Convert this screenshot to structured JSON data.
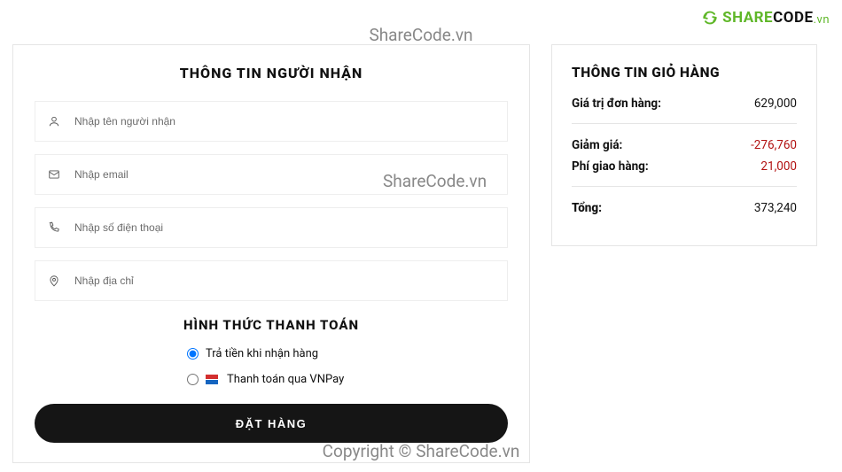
{
  "brand": {
    "share": "SHARE",
    "code": "CODE",
    "vn": ".vn"
  },
  "watermarks": {
    "top": "ShareCode.vn",
    "mid": "ShareCode.vn",
    "bottom": "Copyright © ShareCode.vn"
  },
  "recipient": {
    "title": "THÔNG TIN NGƯỜI NHẬN",
    "name_placeholder": "Nhập tên người nhận",
    "email_placeholder": "Nhập email",
    "phone_placeholder": "Nhập số điện thoại",
    "address_placeholder": "Nhập địa chỉ"
  },
  "payment": {
    "title": "HÌNH THỨC THANH TOÁN",
    "option_cod": "Trả tiền khi nhận hàng",
    "option_vnpay": "Thanh toán qua VNPay"
  },
  "submit_label": "ĐẶT HÀNG",
  "cart": {
    "title": "THÔNG TIN GIỎ HÀNG",
    "order_value_label": "Giá trị đơn hàng:",
    "order_value": "629,000",
    "discount_label": "Giảm giá:",
    "discount": "-276,760",
    "shipping_label": "Phí giao hàng:",
    "shipping": "21,000",
    "total_label": "Tổng:",
    "total": "373,240"
  }
}
